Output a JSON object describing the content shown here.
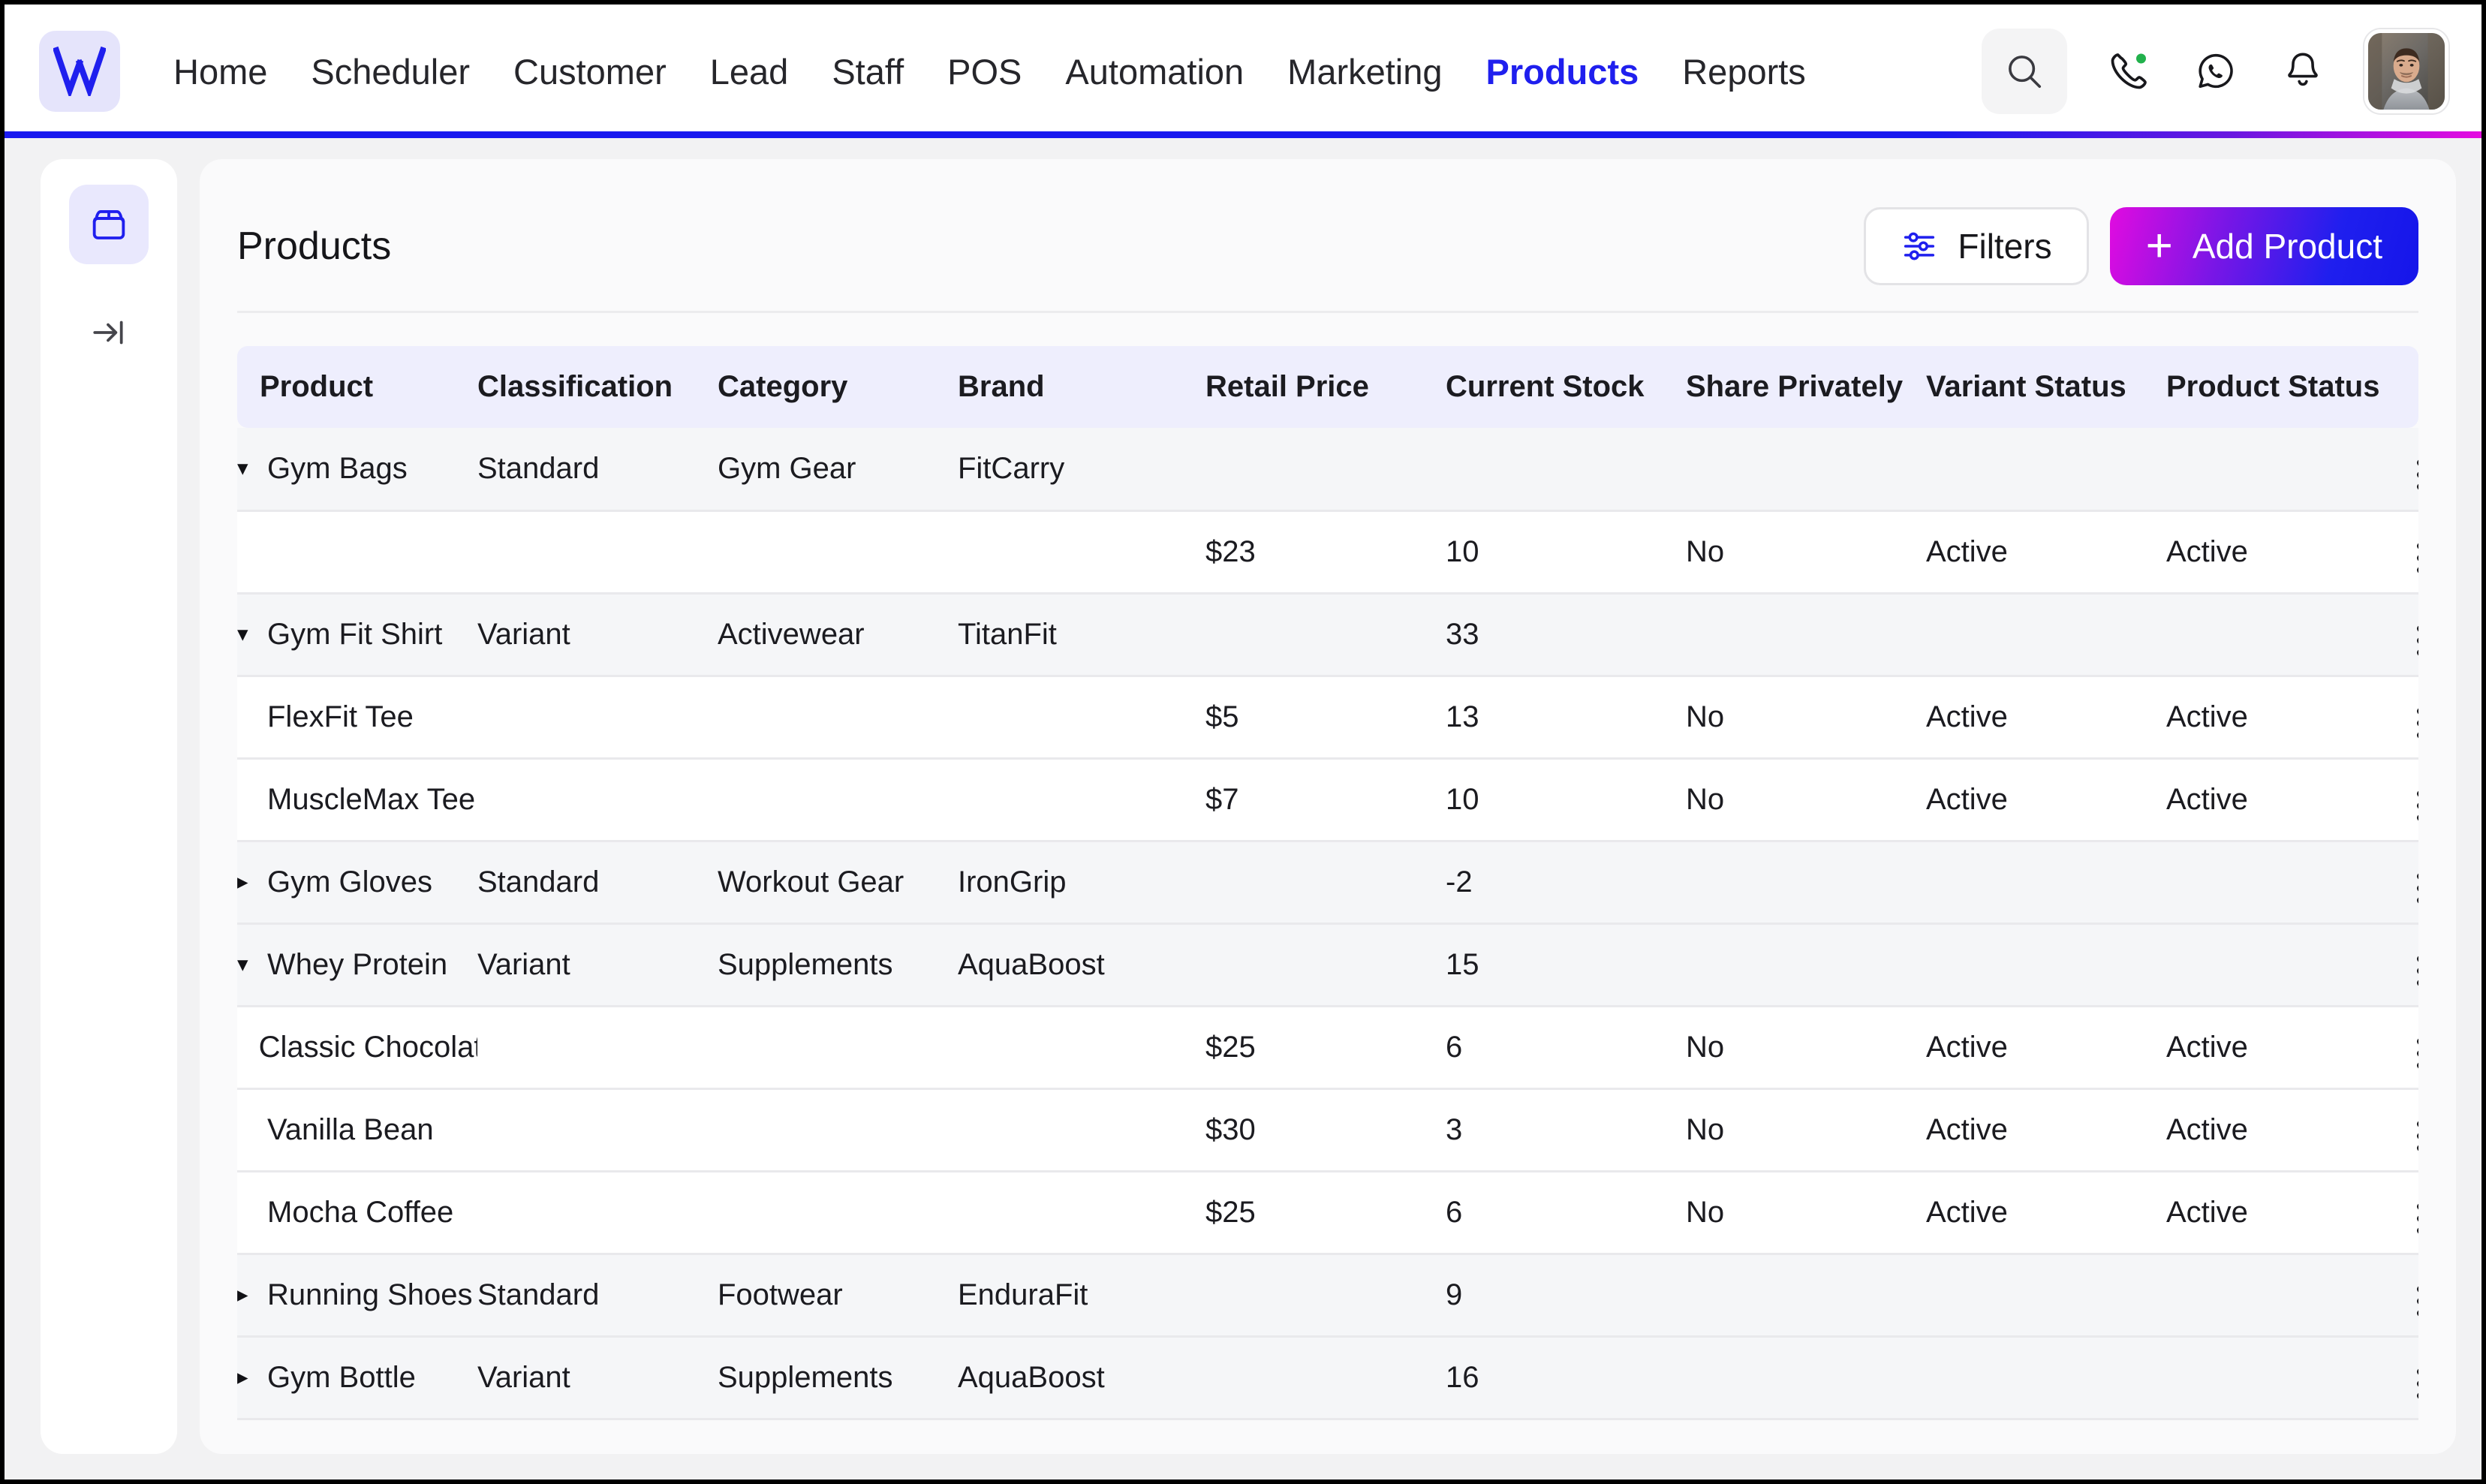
{
  "brand": {
    "logo_letter": "W",
    "accent_blue": "#1f1fee",
    "accent_magenta": "#e50ce0",
    "logo_bg": "#e5e4fb"
  },
  "navbar": {
    "links": [
      {
        "label": "Home",
        "active": false
      },
      {
        "label": "Scheduler",
        "active": false
      },
      {
        "label": "Customer",
        "active": false
      },
      {
        "label": "Lead",
        "active": false
      },
      {
        "label": "Staff",
        "active": false
      },
      {
        "label": "POS",
        "active": false
      },
      {
        "label": "Automation",
        "active": false
      },
      {
        "label": "Marketing",
        "active": false
      },
      {
        "label": "Products",
        "active": true
      },
      {
        "label": "Reports",
        "active": false
      }
    ],
    "icons": {
      "search": "search-icon",
      "call": "phone-call-icon",
      "whatsapp": "whatsapp-icon",
      "notifications": "bell-icon",
      "avatar": "user-avatar"
    },
    "call_status_color": "#22b14c"
  },
  "sidebar": {
    "items": [
      {
        "icon": "package-box-icon",
        "active": true
      },
      {
        "icon": "expand-sidebar-icon",
        "active": false
      }
    ]
  },
  "header": {
    "title": "Products",
    "filters_label": "Filters",
    "add_label": "Add Product",
    "add_plus": "+"
  },
  "table": {
    "columns": [
      "Product",
      "Classification",
      "Category",
      "Brand",
      "Retail Price",
      "Current Stock",
      "Share Privately",
      "Variant Status",
      "Product Status"
    ],
    "rows": [
      {
        "type": "parent",
        "expanded": true,
        "caret": "▾",
        "product": "Gym Bags",
        "classification": "Standard",
        "category": "Gym Gear",
        "brand": "FitCarry",
        "retail_price": "",
        "current_stock": "",
        "share_privately": "",
        "variant_status": "",
        "product_status": ""
      },
      {
        "type": "child",
        "expanded": null,
        "caret": "",
        "product": "",
        "classification": "",
        "category": "",
        "brand": "",
        "retail_price": "$23",
        "current_stock": "10",
        "share_privately": "No",
        "variant_status": "Active",
        "product_status": "Active"
      },
      {
        "type": "parent",
        "expanded": true,
        "caret": "▾",
        "product": "Gym Fit Shirt",
        "classification": "Variant",
        "category": "Activewear",
        "brand": "TitanFit",
        "retail_price": "",
        "current_stock": "33",
        "share_privately": "",
        "variant_status": "",
        "product_status": ""
      },
      {
        "type": "child",
        "expanded": null,
        "caret": "",
        "product": "FlexFit Tee",
        "classification": "",
        "category": "",
        "brand": "",
        "retail_price": "$5",
        "current_stock": "13",
        "share_privately": "No",
        "variant_status": "Active",
        "product_status": "Active"
      },
      {
        "type": "child",
        "expanded": null,
        "caret": "",
        "product": "MuscleMax Tee",
        "classification": "",
        "category": "",
        "brand": "",
        "retail_price": "$7",
        "current_stock": "10",
        "share_privately": "No",
        "variant_status": "Active",
        "product_status": "Active"
      },
      {
        "type": "parent",
        "expanded": false,
        "caret": "▸",
        "product": "Gym Gloves",
        "classification": "Standard",
        "category": "Workout Gear",
        "brand": "IronGrip",
        "retail_price": "",
        "current_stock": "-2",
        "share_privately": "",
        "variant_status": "",
        "product_status": ""
      },
      {
        "type": "parent",
        "expanded": true,
        "caret": "▾",
        "product": "Whey Protein",
        "classification": "Variant",
        "category": "Supplements",
        "brand": "AquaBoost",
        "retail_price": "",
        "current_stock": "15",
        "share_privately": "",
        "variant_status": "",
        "product_status": ""
      },
      {
        "type": "child",
        "expanded": null,
        "caret": "",
        "product": "Classic Chocolate",
        "classification": "",
        "category": "",
        "brand": "",
        "retail_price": "$25",
        "current_stock": "6",
        "share_privately": "No",
        "variant_status": "Active",
        "product_status": "Active"
      },
      {
        "type": "child",
        "expanded": null,
        "caret": "",
        "product": "Vanilla Bean",
        "classification": "",
        "category": "",
        "brand": "",
        "retail_price": "$30",
        "current_stock": "3",
        "share_privately": "No",
        "variant_status": "Active",
        "product_status": "Active"
      },
      {
        "type": "child",
        "expanded": null,
        "caret": "",
        "product": "Mocha Coffee",
        "classification": "",
        "category": "",
        "brand": "",
        "retail_price": "$25",
        "current_stock": "6",
        "share_privately": "No",
        "variant_status": "Active",
        "product_status": "Active"
      },
      {
        "type": "parent",
        "expanded": false,
        "caret": "▸",
        "product": "Running Shoes",
        "classification": "Standard",
        "category": "Footwear",
        "brand": "EnduraFit",
        "retail_price": "",
        "current_stock": "9",
        "share_privately": "",
        "variant_status": "",
        "product_status": ""
      },
      {
        "type": "parent",
        "expanded": false,
        "caret": "▸",
        "product": "Gym Bottle",
        "classification": "Variant",
        "category": "Supplements",
        "brand": "AquaBoost",
        "retail_price": "",
        "current_stock": "16",
        "share_privately": "",
        "variant_status": "",
        "product_status": ""
      }
    ],
    "row_menu_icon": "more-vertical-icon"
  }
}
